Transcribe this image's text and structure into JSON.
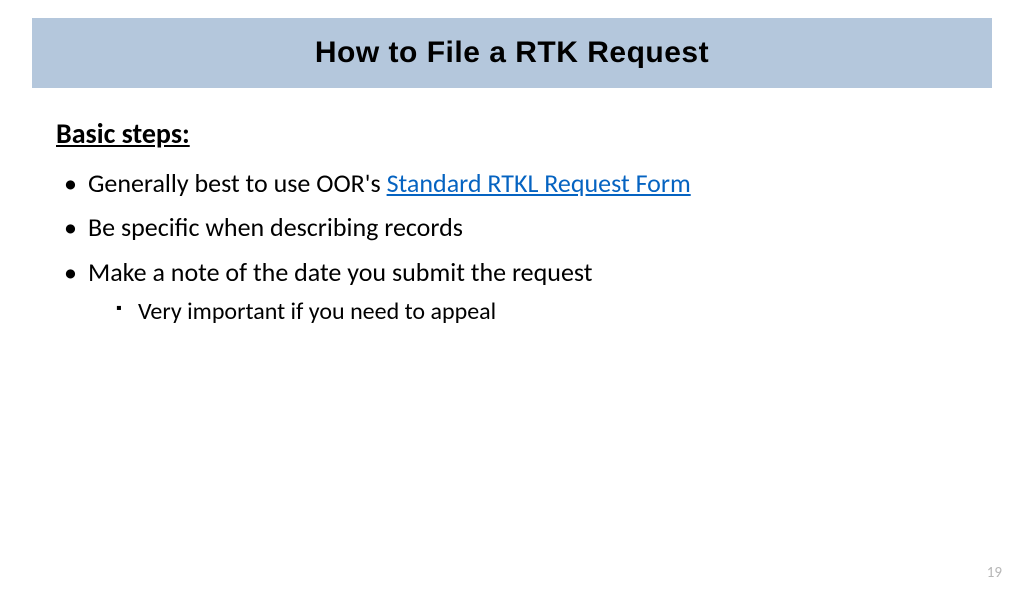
{
  "title": "How to File a RTK Request",
  "subheading": "Basic steps:",
  "bullets": {
    "b1_prefix": "Generally best to use OOR's ",
    "b1_link": "Standard RTKL Request Form",
    "b2": "Be specific when describing records",
    "b3": "Make a note of the date you submit the request",
    "b3_sub1": "Very important if you need to appeal"
  },
  "page_number": "19"
}
